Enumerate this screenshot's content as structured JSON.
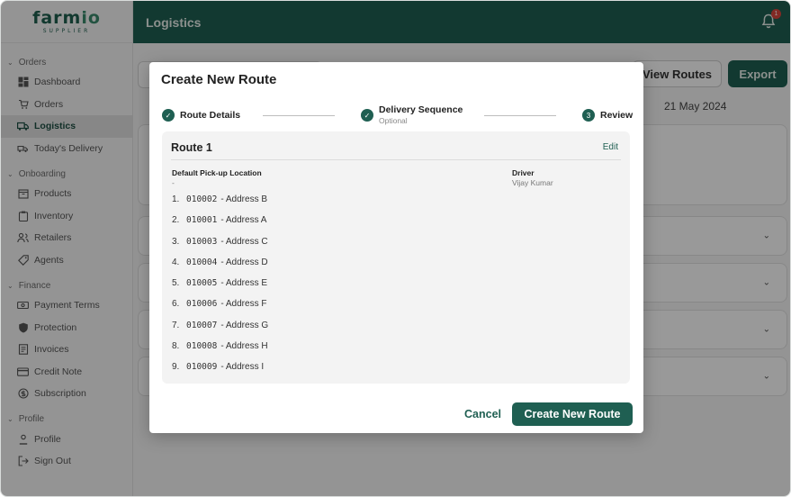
{
  "brand": {
    "logo_main": "farm",
    "logo_accent": "io",
    "logo_sub": "SUPPLIER"
  },
  "header": {
    "title": "Logistics",
    "notification_count": "1"
  },
  "sidebar": {
    "sections": [
      {
        "label": "Orders",
        "items": [
          {
            "label": "Dashboard",
            "icon": "dashboard-icon"
          },
          {
            "label": "Orders",
            "icon": "cart-icon"
          },
          {
            "label": "Logistics",
            "icon": "truck-icon",
            "active": true
          },
          {
            "label": "Today's Delivery",
            "icon": "delivery-icon"
          }
        ]
      },
      {
        "label": "Onboarding",
        "items": [
          {
            "label": "Products",
            "icon": "box-icon"
          },
          {
            "label": "Inventory",
            "icon": "clipboard-icon"
          },
          {
            "label": "Retailers",
            "icon": "users-icon"
          },
          {
            "label": "Agents",
            "icon": "tag-icon"
          }
        ]
      },
      {
        "label": "Finance",
        "items": [
          {
            "label": "Payment Terms",
            "icon": "money-icon"
          },
          {
            "label": "Protection",
            "icon": "shield-icon"
          },
          {
            "label": "Invoices",
            "icon": "invoice-icon"
          },
          {
            "label": "Credit Note",
            "icon": "card-icon"
          },
          {
            "label": "Subscription",
            "icon": "subscription-icon"
          }
        ]
      },
      {
        "label": "Profile",
        "items": [
          {
            "label": "Profile",
            "icon": "user-icon"
          },
          {
            "label": "Sign Out",
            "icon": "signout-icon"
          }
        ]
      }
    ]
  },
  "background": {
    "view_routes": "View Routes",
    "export": "Export",
    "date": "21 May 2024"
  },
  "modal": {
    "title": "Create New Route",
    "steps": [
      {
        "label": "Route Details",
        "status": "done"
      },
      {
        "label": "Delivery Sequence",
        "sub": "Optional",
        "status": "done"
      },
      {
        "label": "Review",
        "number": "3",
        "status": "current"
      }
    ],
    "route": {
      "title": "Route 1",
      "edit": "Edit",
      "pickup_label": "Default Pick-up Location",
      "pickup_value": "-",
      "driver_label": "Driver",
      "driver_value": "Vijay Kumar",
      "stops": [
        {
          "num": "1.",
          "code": "010002",
          "address": "- Address B"
        },
        {
          "num": "2.",
          "code": "010001",
          "address": "- Address A"
        },
        {
          "num": "3.",
          "code": "010003",
          "address": "- Address C"
        },
        {
          "num": "4.",
          "code": "010004",
          "address": "- Address D"
        },
        {
          "num": "5.",
          "code": "010005",
          "address": "- Address E"
        },
        {
          "num": "6.",
          "code": "010006",
          "address": "- Address F"
        },
        {
          "num": "7.",
          "code": "010007",
          "address": "- Address G"
        },
        {
          "num": "8.",
          "code": "010008",
          "address": "- Address H"
        },
        {
          "num": "9.",
          "code": "010009",
          "address": "- Address I"
        }
      ]
    },
    "cancel": "Cancel",
    "create": "Create New Route"
  }
}
